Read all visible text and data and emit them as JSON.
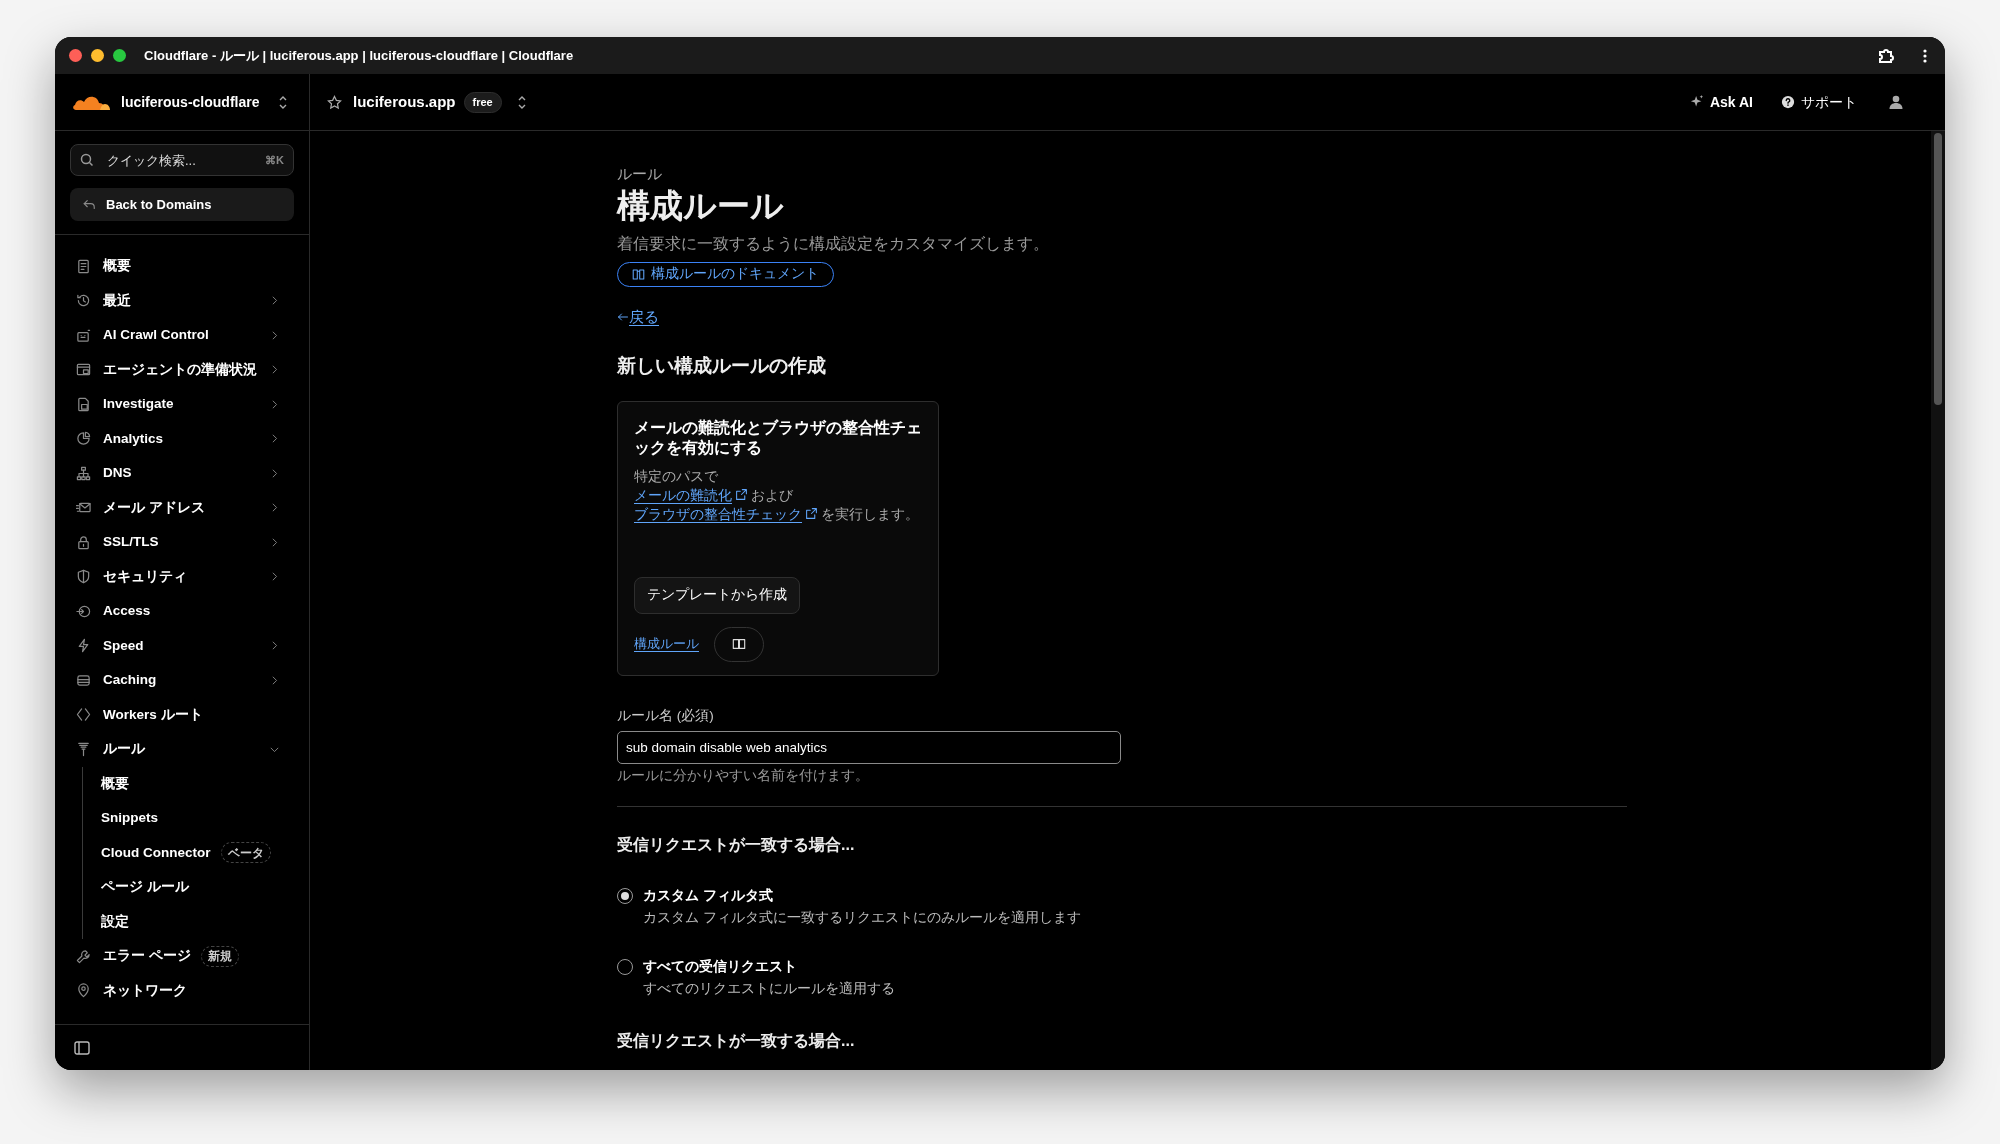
{
  "window": {
    "title": "Cloudflare - ルール | luciferous.app | luciferous-cloudflare | Cloudflare"
  },
  "account": {
    "name": "luciferous-cloudflare"
  },
  "zone": {
    "name": "luciferous.app",
    "plan": "free"
  },
  "top_actions": [
    {
      "label": "Ask AI"
    },
    {
      "label": "サポート"
    }
  ],
  "sidebar": {
    "search": {
      "placeholder": "クイック検索...",
      "shortcut": "⌘K"
    },
    "back": "Back to Domains",
    "items": [
      {
        "label": "概要",
        "kind": "link"
      },
      {
        "label": "最近",
        "kind": "group",
        "expanded": false
      },
      {
        "label": "AI Crawl Control",
        "kind": "group",
        "expanded": false
      },
      {
        "label": "エージェントの準備状況",
        "kind": "group",
        "expanded": false
      },
      {
        "label": "Investigate",
        "kind": "group",
        "expanded": false
      },
      {
        "label": "Analytics",
        "kind": "group",
        "expanded": false
      },
      {
        "label": "DNS",
        "kind": "group",
        "expanded": false
      },
      {
        "label": "メール アドレス",
        "kind": "group",
        "expanded": false
      },
      {
        "label": "SSL/TLS",
        "kind": "group",
        "expanded": false
      },
      {
        "label": "セキュリティ",
        "kind": "group",
        "expanded": false
      },
      {
        "label": "Access",
        "kind": "link"
      },
      {
        "label": "Speed",
        "kind": "group",
        "expanded": false
      },
      {
        "label": "Caching",
        "kind": "group",
        "expanded": false
      },
      {
        "label": "Workers ルート",
        "kind": "link"
      },
      {
        "label": "ルール",
        "kind": "group",
        "expanded": true,
        "children": [
          {
            "label": "概要"
          },
          {
            "label": "Snippets"
          },
          {
            "label": "Cloud Connector",
            "badge": "ベータ"
          },
          {
            "label": "ページ ルール"
          },
          {
            "label": "設定"
          }
        ]
      },
      {
        "label": "エラー ページ",
        "kind": "link",
        "badge": "新規"
      },
      {
        "label": "ネットワーク",
        "kind": "link"
      }
    ]
  },
  "main": {
    "breadcrumb": "ルール",
    "title": "構成ルール",
    "description": "着信要求に一致するように構成設定をカスタマイズします。",
    "docs_link": "構成ルールのドキュメント",
    "back_link": "戻る",
    "section_title": "新しい構成ルールの作成",
    "template_card": {
      "title": "メールの難読化とブラウザの整合性チェックを有効にする",
      "lines": [
        [
          {
            "kind": "text",
            "text": "特定のパスで"
          }
        ],
        [
          {
            "kind": "link",
            "text": "メールの難読化"
          },
          {
            "kind": "text",
            "text": "および"
          }
        ],
        [
          {
            "kind": "link",
            "text": "ブラウザの整合性チェック"
          },
          {
            "kind": "text",
            "text": "を実行します。"
          }
        ]
      ],
      "button": "テンプレートから作成",
      "footer_link": "構成ルール"
    },
    "rule_name": {
      "label": "ルール名 (必須)",
      "value": "sub domain disable web analytics",
      "hint": "ルールに分かりやすい名前を付けます。"
    },
    "match_section": {
      "title": "受信リクエストが一致する場合...",
      "options": [
        {
          "label": "カスタム フィルタ式",
          "description": "カスタム フィルタ式に一致するリクエストにのみルールを適用します",
          "selected": true
        },
        {
          "label": "すべての受信リクエスト",
          "description": "すべてのリクエストにルールを適用する",
          "selected": false
        }
      ]
    },
    "expression_section": {
      "title": "受信リクエストが一致する場合..."
    }
  }
}
